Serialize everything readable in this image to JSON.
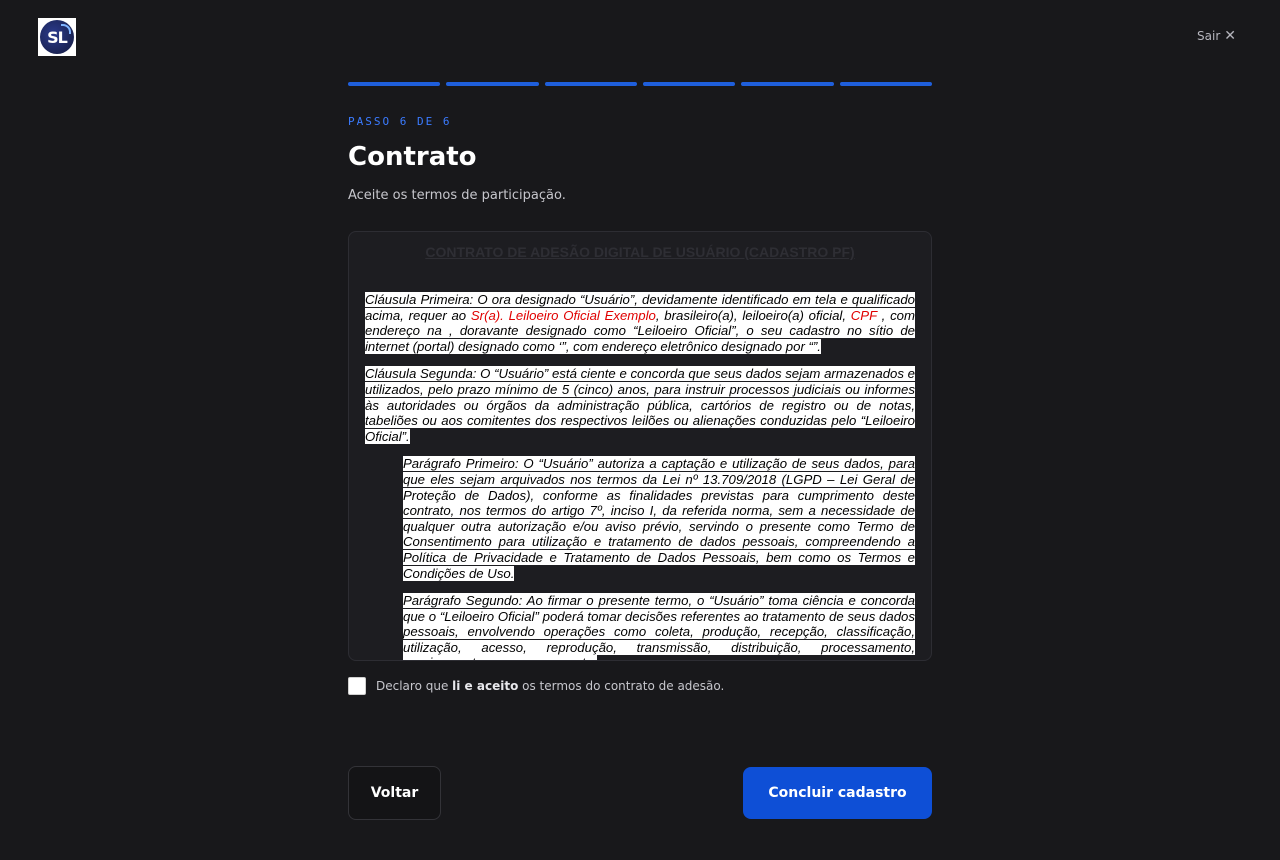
{
  "header": {
    "logo_text": "SL",
    "exit_label": "Sair",
    "exit_icon": "close-icon"
  },
  "progress": {
    "total_steps": 6,
    "completed_steps": 6,
    "active_color": "#1f5fdc"
  },
  "step_label": "PASSO 6 DE 6",
  "title": "Contrato",
  "subtitle": "Aceite os termos de participação.",
  "contract": {
    "heading": "CONTRATO DE ADESÃO DIGITAL DE USUÁRIO (CADASTRO PF)",
    "clause1": {
      "t1": "Cláusula Primeira: O ora designado “Usuário”, devidamente identificado em tela e qualificado acima, requer ao ",
      "r1": "Sr(a). Leiloeiro Oficial Exemplo",
      "t2": ", brasileiro(a), leiloeiro(a) oficial, ",
      "r2": "CPF",
      "t3": " , com endereço na , doravante designado como “Leiloeiro Oficial”, o seu cadastro no sítio de internet (portal) designado como ‘”, com endereço eletrônico designado por “”."
    },
    "clause2": "Cláusula Segunda: O “Usuário” está ciente e concorda que seus dados sejam armazenados e utilizados, pelo prazo mínimo de 5 (cinco) anos, para instruir processos judiciais ou informes às autoridades ou órgãos da administração pública, cartórios de registro ou de notas, tabeliões ou aos comitentes dos respectivos leilões ou alienações conduzidas pelo “Leiloeiro Oficial”.",
    "para1": "Parágrafo Primeiro: O “Usuário” autoriza a captação e utilização de seus dados, para que eles sejam arquivados nos termos da Lei nº 13.709/2018 (LGPD – Lei Geral de Proteção de Dados), conforme as finalidades previstas para cumprimento deste contrato, nos termos do artigo 7º, inciso I, da referida norma, sem a necessidade de qualquer outra autorização e/ou aviso prévio, servindo o presente como Termo de Consentimento para utilização e tratamento de dados pessoais, compreendendo a Política de Privacidade e Tratamento de Dados Pessoais, bem como os Termos e Condições de Uso.",
    "para2": "Parágrafo Segundo: Ao firmar o presente termo, o “Usuário” toma ciência e concorda que o “Leiloeiro Oficial” poderá tomar decisões referentes ao tratamento de seus dados pessoais, envolvendo operações como coleta, produção, recepção, classificação, utilização, acesso, reprodução, transmissão, distribuição, processamento, arquivamento e armazenamento."
  },
  "agreement": {
    "prefix": "Declaro que ",
    "bold": "li e aceito",
    "suffix": " os termos do contrato de adesão."
  },
  "buttons": {
    "back": "Voltar",
    "finish": "Concluir cadastro"
  }
}
